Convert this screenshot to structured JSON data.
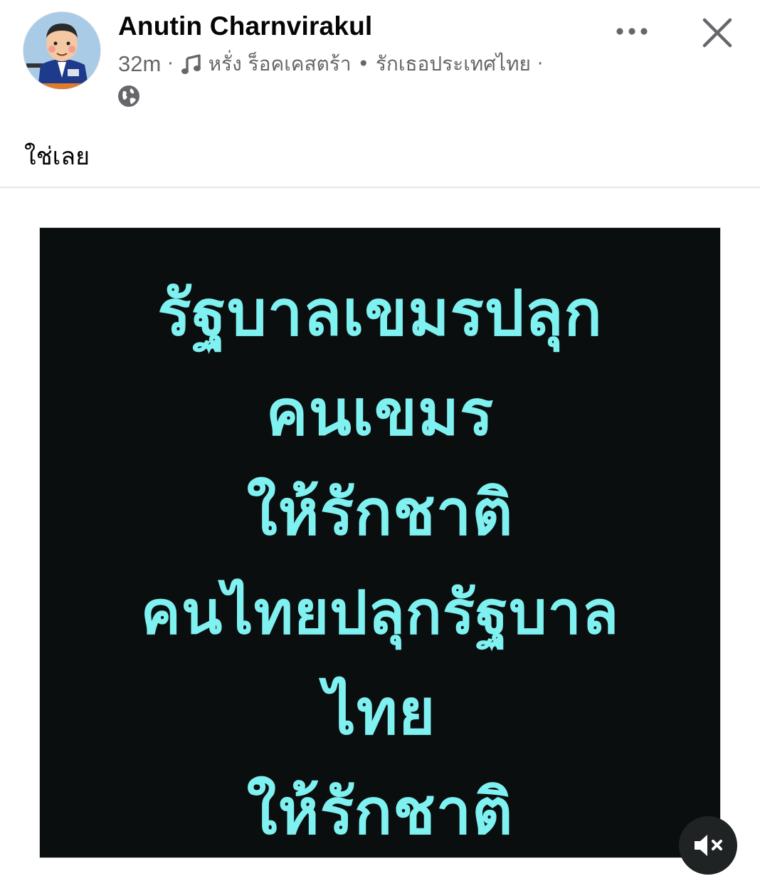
{
  "post": {
    "author": "Anutin Charnvirakul",
    "time": "32m",
    "separator": "·",
    "song": "หรั่ง ร็อคเคสตร้า • รักเธอประเทศไทย",
    "trailing_separator": "·",
    "caption": "ใช่เลย"
  },
  "image": {
    "lines": [
      "รัฐบาลเขมรปลุก",
      "คนเขมร",
      "ให้รักชาติ",
      "คนไทยปลุกรัฐบาล",
      "ไทย",
      "ให้รักชาติ"
    ],
    "text_color": "#7ff1f0",
    "background_color": "#0b0e0f"
  },
  "icons": {
    "music": "music-note-icon",
    "audience": "globe-icon",
    "more": "more-options-icon",
    "close": "close-icon",
    "mute": "speaker-muted-icon"
  },
  "colors": {
    "text_primary": "#050505",
    "text_secondary": "#65676b",
    "divider": "#e4e6eb"
  }
}
